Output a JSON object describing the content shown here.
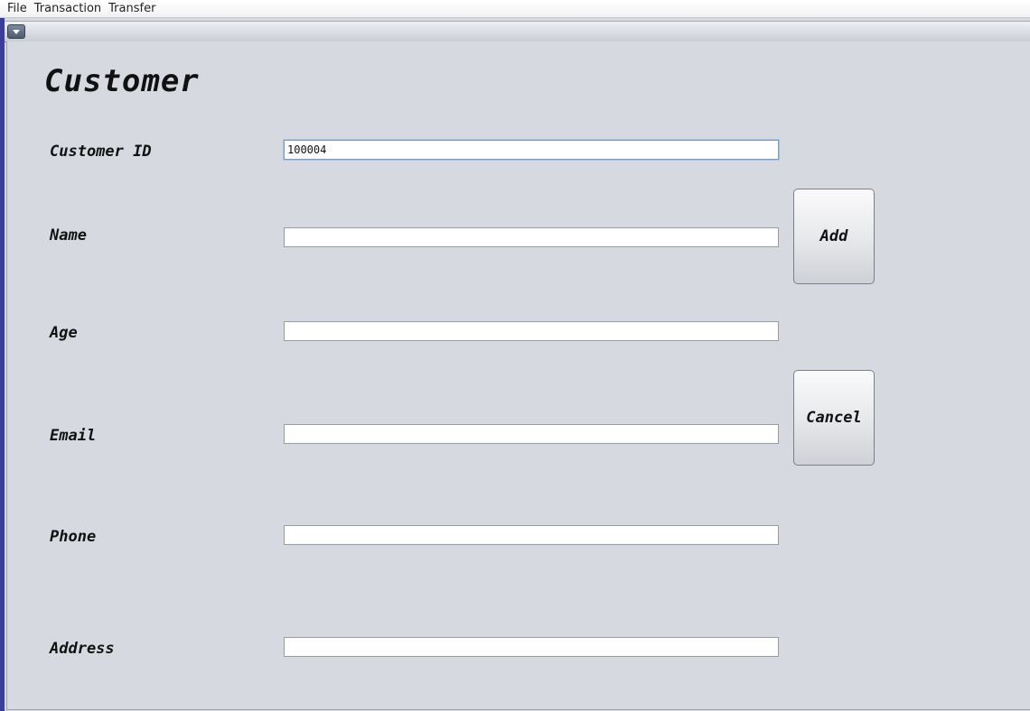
{
  "menubar": {
    "items": [
      "File",
      "Transaction",
      "Transfer"
    ]
  },
  "window": {
    "system_menu_icon": "chevron-down-icon"
  },
  "form": {
    "title": "Customer",
    "fields": {
      "customer_id": {
        "label": "Customer ID",
        "value": "100004"
      },
      "name": {
        "label": "Name",
        "value": ""
      },
      "age": {
        "label": "Age",
        "value": ""
      },
      "email": {
        "label": "Email",
        "value": ""
      },
      "phone": {
        "label": "Phone",
        "value": ""
      },
      "address": {
        "label": "Address",
        "value": ""
      }
    },
    "buttons": {
      "add_label": "Add",
      "cancel_label": "Cancel"
    }
  },
  "colors": {
    "background": "#d6d9e0",
    "frame_accent": "#3a3d9c",
    "focus_border": "#7d9cc4"
  }
}
